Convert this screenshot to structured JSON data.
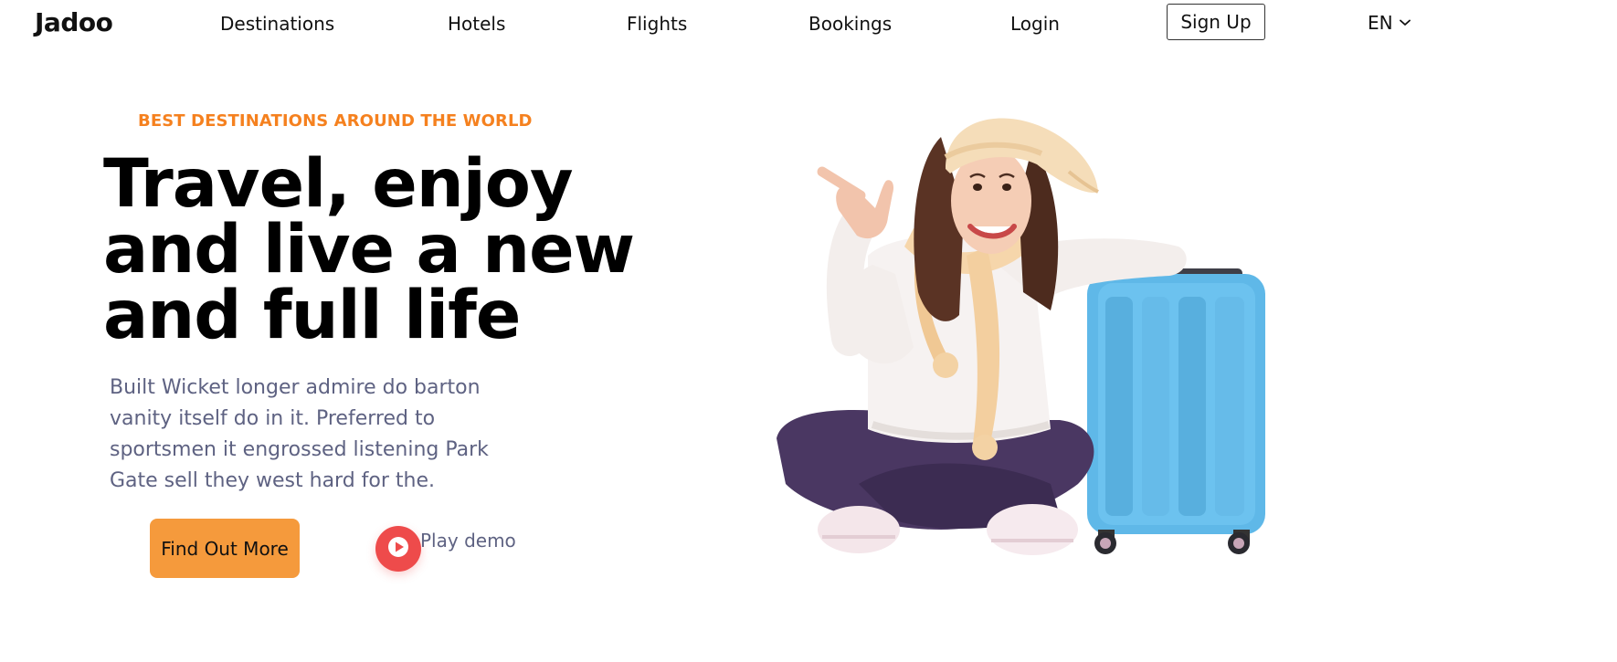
{
  "nav": {
    "brand": "Jadoo",
    "links": [
      "Destinations",
      "Hotels",
      "Flights",
      "Bookings",
      "Login"
    ],
    "signup_label": "Sign Up",
    "language": "EN"
  },
  "hero": {
    "kicker": "BEST DESTINATIONS AROUND THE WORLD",
    "headline_lines": [
      "Travel, enjoy",
      "and live a new",
      "and full life"
    ],
    "lead": "Built Wicket longer admire do barton vanity itself do in it. Preferred to sportsmen it engrossed listening Park Gate sell they west hard for the.",
    "cta_label": "Find Out More",
    "play_label": "Play demo"
  },
  "colors": {
    "accent_orange": "#f5811f",
    "cta_bg": "#f59a3c",
    "play_red": "#ee4b4b",
    "muted_text": "#5e6282",
    "suitcase_blue": "#5fb8e8"
  },
  "icons": {
    "language_dropdown": "chevron-down-icon",
    "play_demo": "play-icon"
  }
}
